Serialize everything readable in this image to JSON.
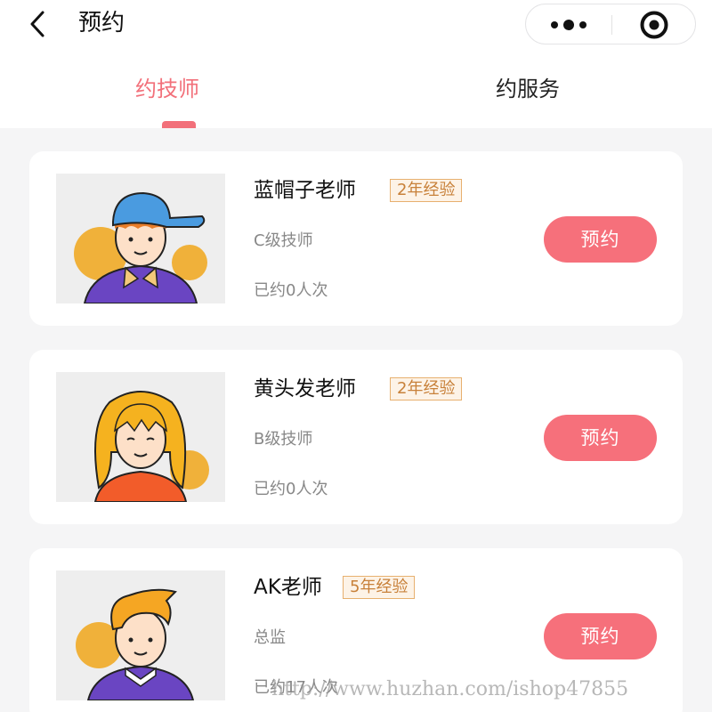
{
  "header": {
    "title": "预约",
    "back_icon": "chevron-left-icon",
    "more_icon": "more-dots-icon",
    "close_icon": "target-icon"
  },
  "tabs": [
    {
      "label": "约技师",
      "active": true
    },
    {
      "label": "约服务",
      "active": false
    }
  ],
  "colors": {
    "accent": "#f2707a",
    "badge_border": "#e7b06f",
    "badge_text": "#c8813a",
    "background": "#f5f5f6"
  },
  "technicians": [
    {
      "name": "蓝帽子老师",
      "experience": "2年经验",
      "level": "C级技师",
      "booked": "已约0人次",
      "button": "预约",
      "avatar": "boy-blue-cap-avatar"
    },
    {
      "name": "黄头发老师",
      "experience": "2年经验",
      "level": "B级技师",
      "booked": "已约0人次",
      "button": "预约",
      "avatar": "girl-yellow-hair-avatar"
    },
    {
      "name": "AK老师",
      "experience": "5年经验",
      "level": "总监",
      "booked": "已约17人次",
      "button": "预约",
      "avatar": "boy-orange-quiff-avatar"
    }
  ],
  "watermark": "http://www.huzhan.com/ishop47855"
}
